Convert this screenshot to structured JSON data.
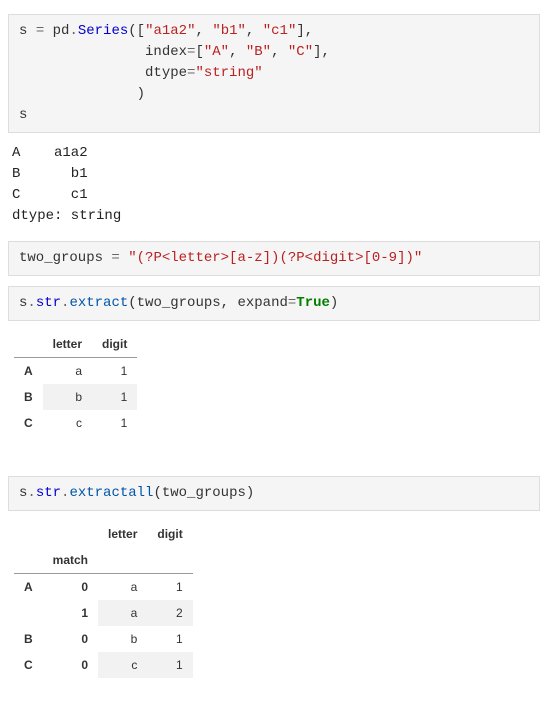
{
  "cell1": {
    "line1_a": "s ",
    "line1_b": " pd",
    "line1_c": "Series",
    "line1_open": "([",
    "line1_s1": "\"a1a2\"",
    "line1_s2": "\"b1\"",
    "line1_s3": "\"c1\"",
    "line1_end": "],",
    "line2_pad": "               index",
    "line2_eq": "=",
    "line2_open": "[",
    "line2_s1": "\"A\"",
    "line2_s2": "\"B\"",
    "line2_s3": "\"C\"",
    "line2_end": "],",
    "line3_pad": "               dtype",
    "line3_eq": "=",
    "line3_s": "\"string\"",
    "line4": "              )",
    "line5": "s"
  },
  "out1": "A    a1a2\nB      b1\nC      c1\ndtype: string",
  "cell2": {
    "lhs": "two_groups ",
    "eq": "=",
    "sp": " ",
    "str": "\"(?P<letter>[a-z])(?P<digit>[0-9])\""
  },
  "cell3": {
    "s": "s",
    "str_": "str",
    "fn": "extract",
    "args_a": "(two_groups, expand",
    "eq": "=",
    "tru": "True",
    "close": ")"
  },
  "table1": {
    "h1": "letter",
    "h2": "digit",
    "rows": [
      {
        "idx": "A",
        "letter": "a",
        "digit": "1"
      },
      {
        "idx": "B",
        "letter": "b",
        "digit": "1"
      },
      {
        "idx": "C",
        "letter": "c",
        "digit": "1"
      }
    ]
  },
  "cell4": {
    "s": "s",
    "str_": "str",
    "fn": "extractall",
    "args": "(two_groups)"
  },
  "table2": {
    "h1": "letter",
    "h2": "digit",
    "sub": "match",
    "rows": [
      {
        "idx": "A",
        "match": "0",
        "letter": "a",
        "digit": "1"
      },
      {
        "idx": "",
        "match": "1",
        "letter": "a",
        "digit": "2"
      },
      {
        "idx": "B",
        "match": "0",
        "letter": "b",
        "digit": "1"
      },
      {
        "idx": "C",
        "match": "0",
        "letter": "c",
        "digit": "1"
      }
    ]
  }
}
